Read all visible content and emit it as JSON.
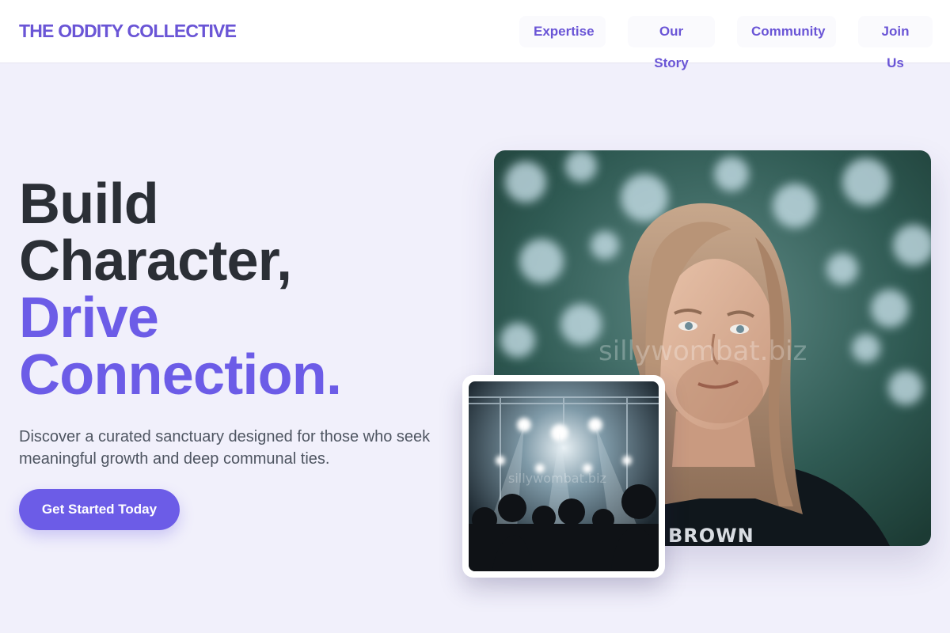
{
  "header": {
    "logo": "THE ODDITY COLLECTIVE",
    "nav": [
      {
        "label": "Expertise"
      },
      {
        "label": "Our Story"
      },
      {
        "label": "Community"
      },
      {
        "label": "Join Us"
      }
    ]
  },
  "hero": {
    "title_line1": "Build",
    "title_line2": "Character,",
    "title_line3": "Drive",
    "title_line4": "Connection.",
    "description": "Discover a curated sanctuary designed for those who seek meaningful growth and deep communal ties.",
    "cta_label": "Get Started Today"
  },
  "images": {
    "portrait": {
      "subject": "long-haired young man in front of blurred foliage",
      "watermark": "sillywombat.biz",
      "shirt_text": "BROWN"
    },
    "concert": {
      "subject": "crowd at concert stage with lights",
      "watermark": "sillywombat.biz"
    }
  },
  "colors": {
    "accent": "#6c5ce7",
    "logo": "#6a55d6",
    "heading": "#2b2f36",
    "background": "#f1f0fb"
  }
}
